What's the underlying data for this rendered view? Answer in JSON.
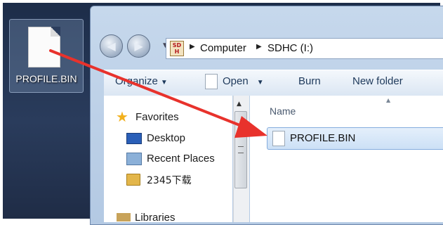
{
  "desktop": {
    "icon": {
      "name": "file-icon",
      "label": "PROFILE.BIN"
    }
  },
  "explorer": {
    "address": {
      "drive_icon_text": "SD\nH",
      "crumbs": [
        "Computer",
        "SDHC (I:)"
      ]
    },
    "toolbar": {
      "organize": "Organize",
      "open": "Open",
      "burn": "Burn",
      "new_folder": "New folder"
    },
    "nav": {
      "favorites": "Favorites",
      "items": [
        "Desktop",
        "Recent Places",
        "2345下载"
      ],
      "libraries": "Libraries"
    },
    "files": {
      "column_name": "Name",
      "items": [
        {
          "name": "PROFILE.BIN",
          "selected": true
        }
      ]
    }
  },
  "colors": {
    "arrow": "#e8322c",
    "accent": "#1e395b"
  }
}
